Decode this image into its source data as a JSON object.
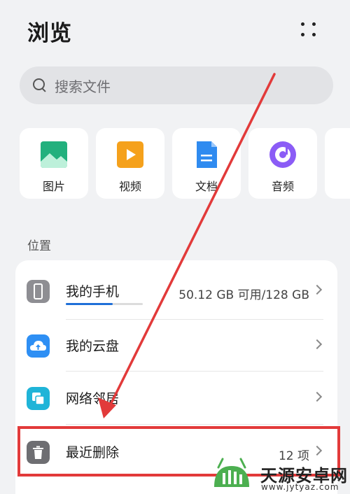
{
  "header": {
    "title": "浏览"
  },
  "search": {
    "placeholder": "搜索文件"
  },
  "categories": [
    {
      "label": "图片",
      "icon": "image-icon",
      "color": "#22b07d"
    },
    {
      "label": "视频",
      "icon": "video-icon",
      "color": "#f5a11c"
    },
    {
      "label": "文档",
      "icon": "document-icon",
      "color": "#2f8bf0"
    },
    {
      "label": "音频",
      "icon": "audio-icon",
      "color": "#8b5cf6"
    }
  ],
  "locations": {
    "title": "位置",
    "items": [
      {
        "label": "我的手机",
        "value": "50.12 GB 可用/128 GB",
        "icon": "phone-icon",
        "storage_used_fraction": 0.61
      },
      {
        "label": "我的云盘",
        "value": "",
        "icon": "cloud-icon"
      },
      {
        "label": "网络邻居",
        "value": "",
        "icon": "network-icon"
      },
      {
        "label": "最近删除",
        "value": "12 项",
        "icon": "trash-icon"
      }
    ]
  },
  "watermark": {
    "name": "天源安卓网",
    "url": "www.jytyaz.com"
  },
  "colors": {
    "accent": "#1f6fd8",
    "annotation": "#e23a3a"
  }
}
